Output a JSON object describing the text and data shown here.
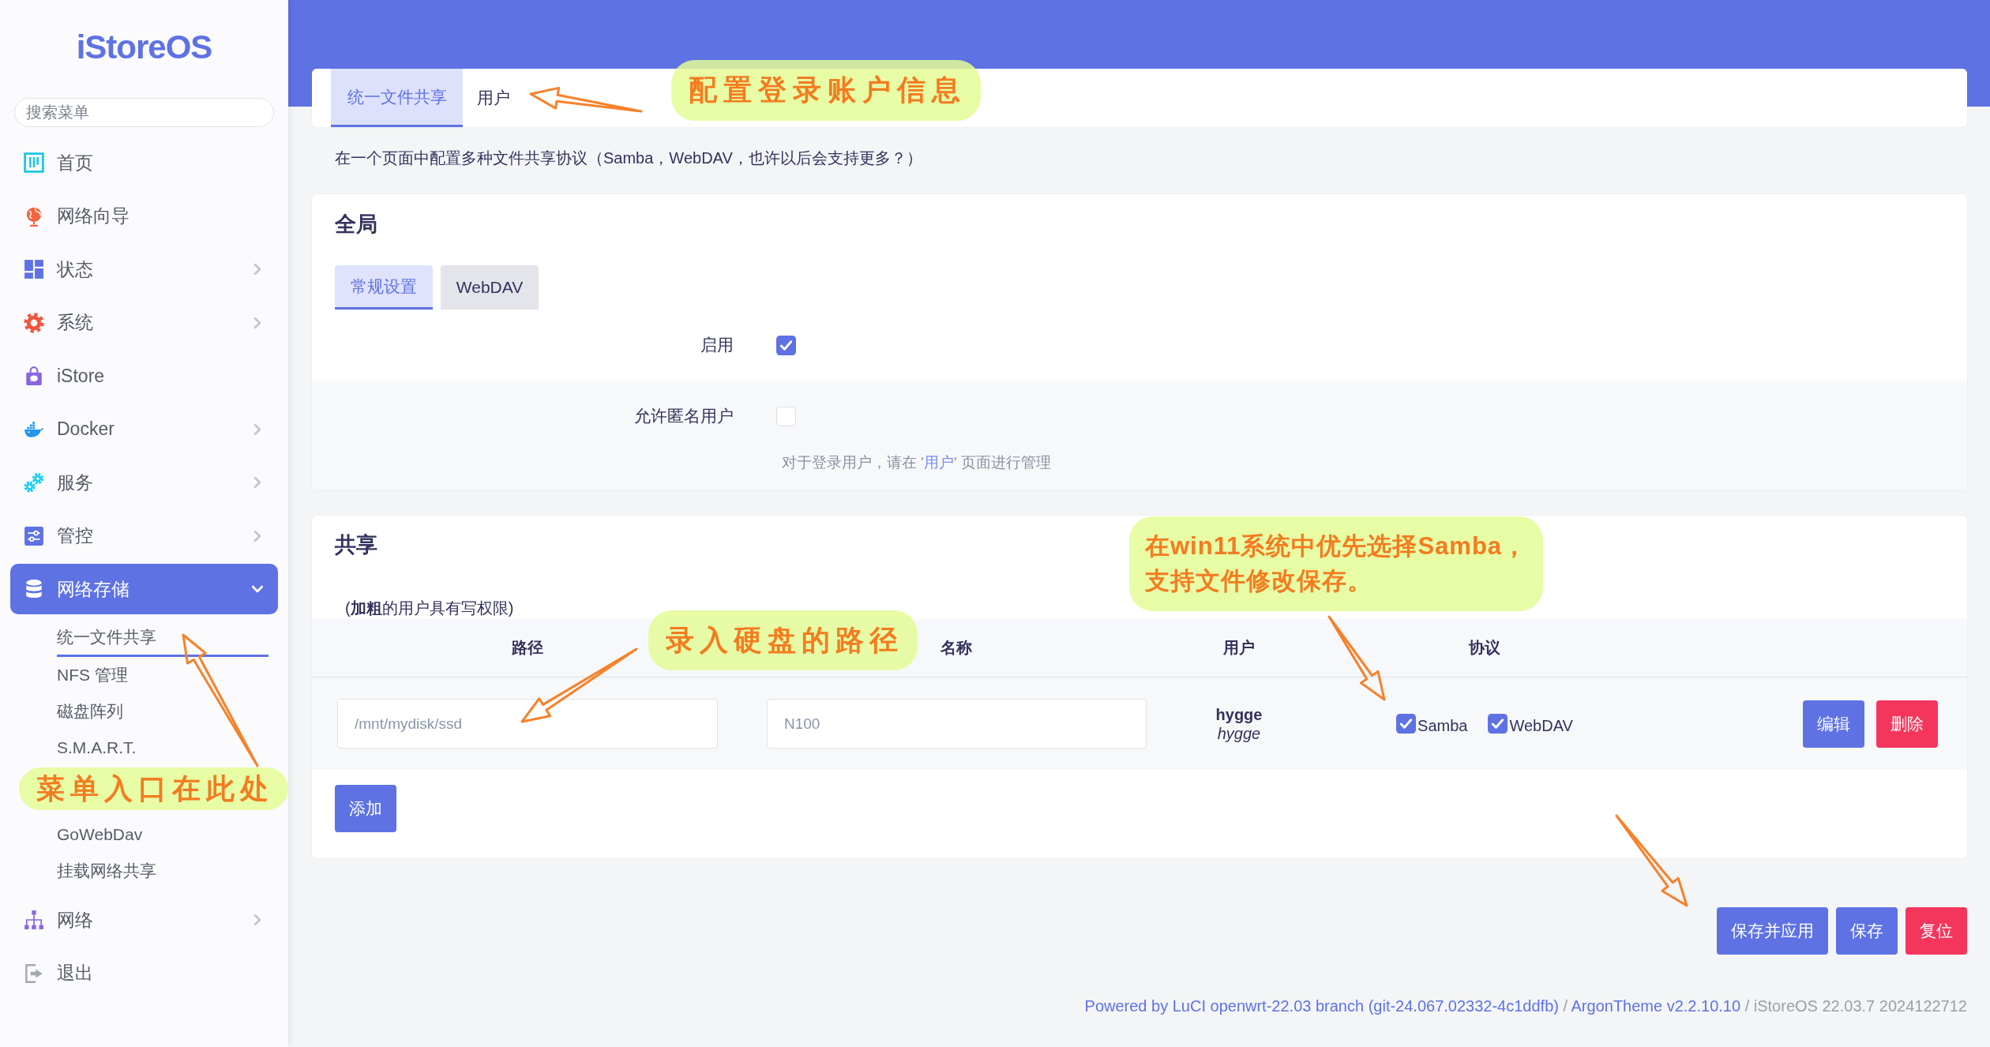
{
  "sidebar": {
    "logo": "iStoreOS",
    "search": {
      "placeholder": "搜索菜单"
    },
    "items": [
      {
        "label": "首页",
        "submenu": false,
        "expanded": false,
        "selected": false
      },
      {
        "label": "网络向导",
        "submenu": false,
        "expanded": false,
        "selected": false
      },
      {
        "label": "状态",
        "submenu": true,
        "expanded": false,
        "selected": false
      },
      {
        "label": "系统",
        "submenu": true,
        "expanded": false,
        "selected": false
      },
      {
        "label": "iStore",
        "submenu": false,
        "expanded": false,
        "selected": false
      },
      {
        "label": "Docker",
        "submenu": true,
        "expanded": false,
        "selected": false
      },
      {
        "label": "服务",
        "submenu": true,
        "expanded": false,
        "selected": false
      },
      {
        "label": "管控",
        "submenu": true,
        "expanded": false,
        "selected": false
      },
      {
        "label": "网络存储",
        "submenu": true,
        "expanded": true,
        "selected": true,
        "children": [
          {
            "label": "统一文件共享",
            "selected": true
          },
          {
            "label": "NFS 管理",
            "selected": false
          },
          {
            "label": "磁盘阵列",
            "selected": false
          },
          {
            "label": "S.M.A.R.T.",
            "selected": false
          },
          {
            "label": "GoWebDav",
            "selected": false
          },
          {
            "label": "挂载网络共享",
            "selected": false
          }
        ]
      },
      {
        "label": "网络",
        "submenu": true,
        "expanded": false,
        "selected": false
      },
      {
        "label": "退出",
        "submenu": false,
        "expanded": false,
        "selected": false
      }
    ]
  },
  "tabs": [
    {
      "label": "统一文件共享",
      "selected": true
    },
    {
      "label": "用户",
      "selected": false
    }
  ],
  "description": "在一个页面中配置多种文件共享协议（Samba，WebDAV，也许以后会支持更多？）",
  "global": {
    "title": "全局",
    "tabs": [
      {
        "label": "常规设置",
        "selected": true
      },
      {
        "label": "WebDAV",
        "selected": false
      }
    ],
    "fields": [
      {
        "label": "启用",
        "checked": true
      },
      {
        "label": "允许匿名用户",
        "checked": false,
        "hint": {
          "before": "对于登录用户，请在 '",
          "link": "用户",
          "after": "' 页面进行管理"
        }
      }
    ]
  },
  "shares": {
    "title": "共享",
    "note": "(**加粗**的用户具有写权限)",
    "columns": [
      "路径",
      "名称",
      "用户",
      "协议"
    ],
    "rows": [
      {
        "path": "/mnt/mydisk/ssd",
        "name": "N100",
        "users": [
          {
            "name": "hygge",
            "writable": true
          },
          {
            "name": "hygge",
            "writable": false
          }
        ],
        "protocols": [
          {
            "label": "Samba",
            "checked": true
          },
          {
            "label": "WebDAV",
            "checked": true
          }
        ],
        "actions": [
          {
            "label": "编辑",
            "kind": "primary"
          },
          {
            "label": "删除",
            "kind": "danger"
          }
        ]
      }
    ],
    "add_button": "添加"
  },
  "actions": [
    {
      "label": "保存并应用",
      "kind": "primary"
    },
    {
      "label": "保存",
      "kind": "primary"
    },
    {
      "label": "复位",
      "kind": "danger"
    }
  ],
  "footer": [
    {
      "text": "Powered by LuCI openwrt-22.03 branch (git-24.067.02332-4c1ddfb)",
      "kind": "link"
    },
    {
      "text": " / ",
      "kind": "plain"
    },
    {
      "text": "ArgonTheme v2.2.10.10",
      "kind": "link"
    },
    {
      "text": " / iStoreOS 22.03.7 2024122712",
      "kind": "plain"
    }
  ],
  "annotations": [
    {
      "lines": [
        "配置登录账户信息"
      ]
    },
    {
      "lines": [
        "在win11系统中优先选择Samba，",
        "支持文件修改保存。"
      ]
    },
    {
      "lines": [
        "录入硬盘的路径"
      ]
    },
    {
      "lines": [
        "菜单入口在此处"
      ]
    }
  ]
}
